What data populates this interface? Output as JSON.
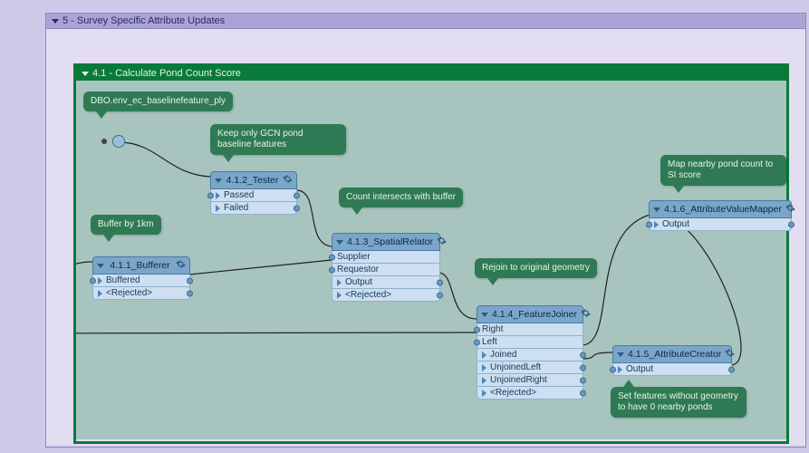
{
  "bookmarks": {
    "outer": {
      "title": "5 - Survey Specific Attribute Updates"
    },
    "inner": {
      "title": "4.1 - Calculate Pond Count Score"
    }
  },
  "annotations": {
    "reader": "DBO.env_ec_baselinefeature_ply",
    "buffer": "Buffer by 1km",
    "tester": "Keep only GCN pond baseline features",
    "relator": "Count intersects with buffer",
    "joiner": "Rejoin to original geometry",
    "creator": "Set features without geometry to have 0 nearby ponds",
    "mapper": "Map nearby pond count to SI score"
  },
  "transformers": {
    "bufferer": {
      "title": "4.1.1_Bufferer",
      "ports": [
        "Buffered",
        "<Rejected>"
      ]
    },
    "tester": {
      "title": "4.1.2_Tester",
      "ports": [
        "Passed",
        "Failed"
      ]
    },
    "relator": {
      "title": "4.1.3_SpatialRelator",
      "ports": [
        "Supplier",
        "Requestor",
        "Output",
        "<Rejected>"
      ]
    },
    "joiner": {
      "title": "4.1.4_FeatureJoiner",
      "ports": [
        "Right",
        "Left",
        "Joined",
        "UnjoinedLeft",
        "UnjoinedRight",
        "<Rejected>"
      ]
    },
    "creator": {
      "title": "4.1.5_AttributeCreator",
      "ports": [
        "Output"
      ]
    },
    "mapper": {
      "title": "4.1.6_AttributeValueMapper",
      "ports": [
        "Output"
      ]
    }
  }
}
